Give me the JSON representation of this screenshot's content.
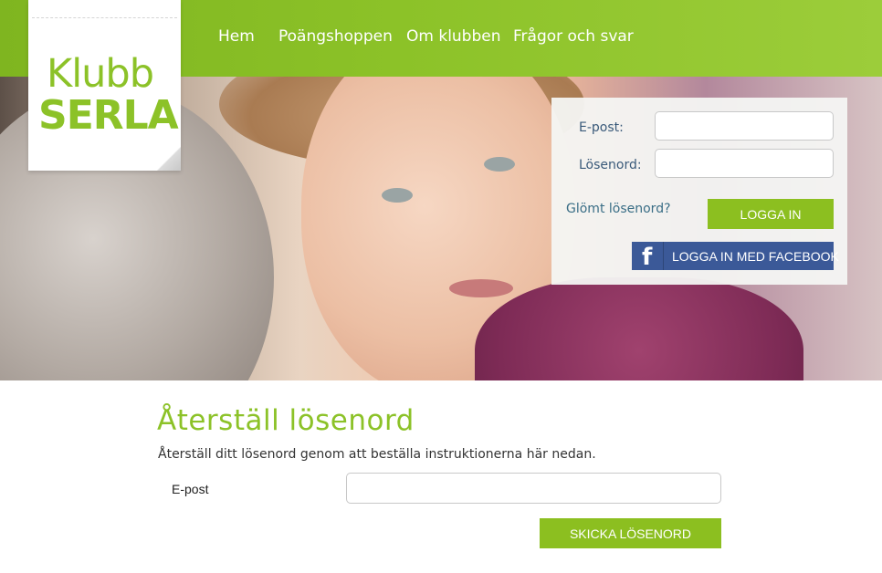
{
  "colors": {
    "brand_green": "#8cc228",
    "button_green": "#8cbf20",
    "facebook_blue": "#3b5998",
    "label_blue": "#3a5a7a"
  },
  "logo": {
    "line1": "Klubb",
    "line2": "SERLA"
  },
  "nav": {
    "items": [
      {
        "label": "Hem"
      },
      {
        "label": "Poängshoppen"
      },
      {
        "label": "Om klubben"
      },
      {
        "label": "Frågor och svar"
      }
    ]
  },
  "login": {
    "email_label": "E-post:",
    "email_value": "",
    "password_label": "Lösenord:",
    "password_value": "",
    "forgot_link": "Glömt lösenord?",
    "login_button": "LOGGA IN",
    "facebook_icon": "facebook-f-icon",
    "facebook_button": "LOGGA IN MED FACEBOOK"
  },
  "reset": {
    "title": "Återställ lösenord",
    "description": "Återställ ditt lösenord genom att beställa instruktionerna här nedan.",
    "email_label": "E-post",
    "email_value": "",
    "submit_button": "SKICKA LÖSENORD"
  }
}
